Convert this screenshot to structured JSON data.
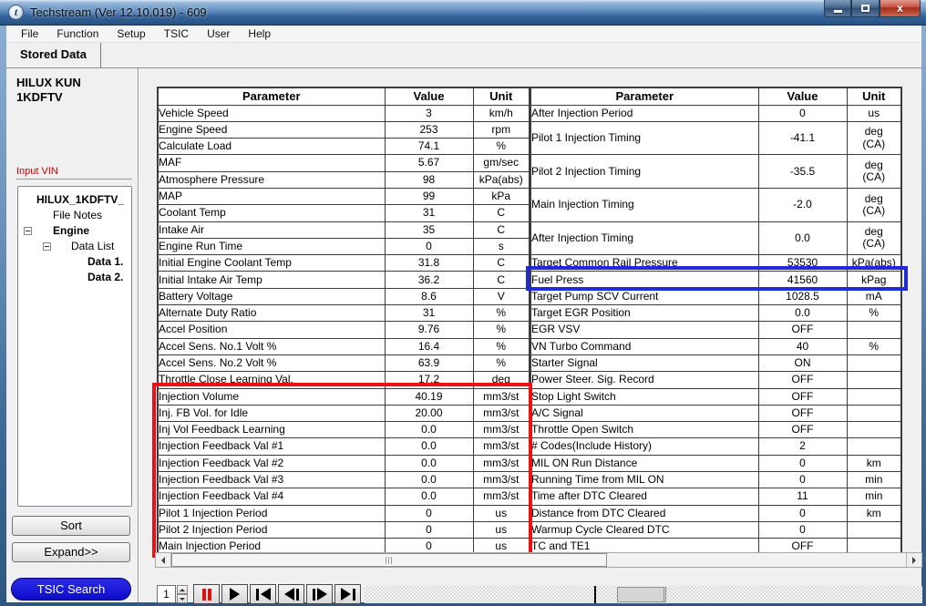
{
  "window": {
    "title": "Techstream (Ver 12.10.019) - 609",
    "app_icon_letter": "t"
  },
  "menu": {
    "items": [
      "File",
      "Function",
      "Setup",
      "TSIC",
      "User",
      "Help"
    ]
  },
  "tab": {
    "label": "Stored Data"
  },
  "sidebar": {
    "vehicle_label": "HILUX KUN\n1KDFTV",
    "input_vin_label": "Input VIN",
    "tree": [
      {
        "label": "HILUX_1KDFTV_",
        "bold": true,
        "indent": 0,
        "expander": false
      },
      {
        "label": "File Notes",
        "bold": false,
        "indent": 1,
        "expander": false
      },
      {
        "label": "Engine",
        "bold": true,
        "indent": 1,
        "expander": true
      },
      {
        "label": "Data List",
        "bold": false,
        "indent": 2,
        "expander": true
      },
      {
        "label": "Data 1.",
        "bold": true,
        "indent": 3,
        "expander": false
      },
      {
        "label": "Data 2.",
        "bold": true,
        "indent": 3,
        "expander": false
      }
    ],
    "sort_label": "Sort",
    "expand_label": "Expand>>",
    "tsic_label": "TSIC Search"
  },
  "tables": {
    "headers": [
      "Parameter",
      "Value",
      "Unit"
    ],
    "left": {
      "rows": [
        {
          "p": "Vehicle Speed",
          "v": "3",
          "u": "km/h"
        },
        {
          "p": "Engine Speed",
          "v": "253",
          "u": "rpm"
        },
        {
          "p": "Calculate Load",
          "v": "74.1",
          "u": "%"
        },
        {
          "p": "MAF",
          "v": "5.67",
          "u": "gm/sec"
        },
        {
          "p": "Atmosphere Pressure",
          "v": "98",
          "u": "kPa(abs)"
        },
        {
          "p": "MAP",
          "v": "99",
          "u": "kPa"
        },
        {
          "p": "Coolant Temp",
          "v": "31",
          "u": "C"
        },
        {
          "p": "Intake Air",
          "v": "35",
          "u": "C"
        },
        {
          "p": "Engine Run Time",
          "v": "0",
          "u": "s"
        },
        {
          "p": "Initial Engine Coolant Temp",
          "v": "31.8",
          "u": "C"
        },
        {
          "p": "Initial Intake Air Temp",
          "v": "36.2",
          "u": "C"
        },
        {
          "p": "Battery Voltage",
          "v": "8.6",
          "u": "V"
        },
        {
          "p": "Alternate Duty Ratio",
          "v": "31",
          "u": "%"
        },
        {
          "p": "Accel Position",
          "v": "9.76",
          "u": "%"
        },
        {
          "p": "Accel Sens. No.1 Volt %",
          "v": "16.4",
          "u": "%"
        },
        {
          "p": "Accel Sens. No.2 Volt %",
          "v": "63.9",
          "u": "%"
        },
        {
          "p": "Throttle Close Learning Val.",
          "v": "17.2",
          "u": "deg"
        },
        {
          "p": "Injection Volume",
          "v": "40.19",
          "u": "mm3/st"
        },
        {
          "p": "Inj. FB Vol. for Idle",
          "v": "20.00",
          "u": "mm3/st"
        },
        {
          "p": "Inj Vol Feedback Learning",
          "v": "0.0",
          "u": "mm3/st"
        },
        {
          "p": "Injection Feedback Val #1",
          "v": "0.0",
          "u": "mm3/st"
        },
        {
          "p": "Injection Feedback Val #2",
          "v": "0.0",
          "u": "mm3/st"
        },
        {
          "p": "Injection Feedback Val #3",
          "v": "0.0",
          "u": "mm3/st"
        },
        {
          "p": "Injection Feedback Val #4",
          "v": "0.0",
          "u": "mm3/st"
        },
        {
          "p": "Pilot 1 Injection Period",
          "v": "0",
          "u": "us"
        },
        {
          "p": "Pilot 2 Injection Period",
          "v": "0",
          "u": "us"
        },
        {
          "p": "Main Injection Period",
          "v": "0",
          "u": "us"
        }
      ]
    },
    "right": {
      "rows": [
        {
          "p": "After Injection Period",
          "v": "0",
          "u": "us"
        },
        {
          "p": "Pilot 1 Injection Timing",
          "v": "-41.1",
          "u": "deg\n(CA)",
          "tall": true
        },
        {
          "p": "Pilot 2 Injection Timing",
          "v": "-35.5",
          "u": "deg\n(CA)",
          "tall": true
        },
        {
          "p": "Main Injection Timing",
          "v": "-2.0",
          "u": "deg\n(CA)",
          "tall": true
        },
        {
          "p": "After Injection Timing",
          "v": "0.0",
          "u": "deg\n(CA)",
          "tall": true
        },
        {
          "p": "Target Common Rail Pressure",
          "v": "53530",
          "u": "kPa(abs)"
        },
        {
          "p": "Fuel Press",
          "v": "41560",
          "u": "kPag"
        },
        {
          "p": "Target Pump SCV Current",
          "v": "1028.5",
          "u": "mA"
        },
        {
          "p": "Target EGR Position",
          "v": "0.0",
          "u": "%"
        },
        {
          "p": "EGR VSV",
          "v": "OFF",
          "u": ""
        },
        {
          "p": "VN Turbo Command",
          "v": "40",
          "u": "%"
        },
        {
          "p": "Starter Signal",
          "v": "ON",
          "u": ""
        },
        {
          "p": "Power Steer. Sig. Record",
          "v": "OFF",
          "u": ""
        },
        {
          "p": "Stop Light Switch",
          "v": "OFF",
          "u": ""
        },
        {
          "p": "A/C Signal",
          "v": "OFF",
          "u": ""
        },
        {
          "p": "Throttle Open Switch",
          "v": "OFF",
          "u": ""
        },
        {
          "p": "# Codes(Include History)",
          "v": "2",
          "u": ""
        },
        {
          "p": "MIL ON Run Distance",
          "v": "0",
          "u": "km"
        },
        {
          "p": "Running Time from MIL ON",
          "v": "0",
          "u": "min"
        },
        {
          "p": "Time after DTC Cleared",
          "v": "11",
          "u": "min"
        },
        {
          "p": "Distance from DTC Cleared",
          "v": "0",
          "u": "km"
        },
        {
          "p": "Warmup Cycle Cleared DTC",
          "v": "0",
          "u": ""
        },
        {
          "p": "TC and TE1",
          "v": "OFF",
          "u": ""
        }
      ]
    }
  },
  "highlights": {
    "red_box_color": "#ee1111",
    "red_box_rows": "Injection Volume through Main Injection Period",
    "blue_box_color": "#1f2bd8",
    "blue_box_row": "Fuel Press"
  },
  "playback": {
    "frame_number": "1"
  },
  "colors": {
    "tsic_button_blue": "#0d0dc8",
    "input_vin_red": "#cc0000"
  }
}
